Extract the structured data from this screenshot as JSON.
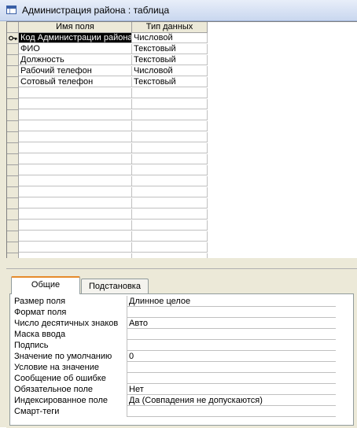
{
  "window": {
    "title": "Администрация района : таблица",
    "icon": "table-icon"
  },
  "grid": {
    "columns": [
      "Имя поля",
      "Тип данных"
    ],
    "rows": [
      {
        "name": "Код Администрации района",
        "type": "Числовой",
        "key": true
      },
      {
        "name": "ФИО",
        "type": "Текстовый",
        "key": false
      },
      {
        "name": "Должность",
        "type": "Текстовый",
        "key": false
      },
      {
        "name": "Рабочий телефон",
        "type": "Числовой",
        "key": false
      },
      {
        "name": "Сотовый телефон",
        "type": "Текстовый",
        "key": false
      }
    ]
  },
  "tabs": [
    {
      "label": "Общие",
      "active": true
    },
    {
      "label": "Подстановка",
      "active": false
    }
  ],
  "properties": [
    {
      "label": "Размер поля",
      "value": "Длинное целое"
    },
    {
      "label": "Формат поля",
      "value": ""
    },
    {
      "label": "Число десятичных знаков",
      "value": "Авто"
    },
    {
      "label": "Маска ввода",
      "value": ""
    },
    {
      "label": "Подпись",
      "value": ""
    },
    {
      "label": "Значение по умолчанию",
      "value": "0"
    },
    {
      "label": "Условие на значение",
      "value": ""
    },
    {
      "label": "Сообщение об ошибке",
      "value": ""
    },
    {
      "label": "Обязательное поле",
      "value": "Нет"
    },
    {
      "label": "Индексированное поле",
      "value": "Да (Совпадения не допускаются)"
    },
    {
      "label": "Смарт-теги",
      "value": ""
    }
  ]
}
